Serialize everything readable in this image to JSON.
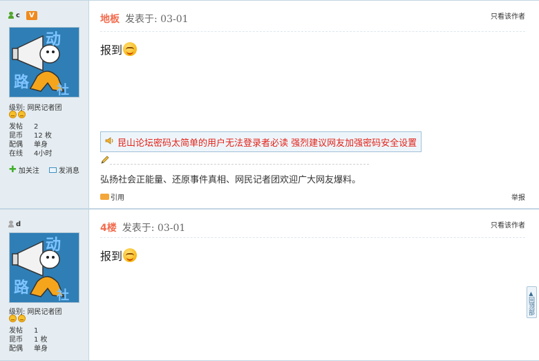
{
  "posts": [
    {
      "username": "c",
      "badge": "V",
      "level_label": "级别: 网民记者团",
      "stats": [
        {
          "k": "发帖",
          "v": "2"
        },
        {
          "k": "昆币",
          "v": "12 枚"
        },
        {
          "k": "配偶",
          "v": "单身"
        },
        {
          "k": "在线",
          "v": "4小时"
        }
      ],
      "follow_label": "加关注",
      "message_label": "发消息",
      "floor": "地板",
      "posted": "发表于: 03-01",
      "only_author": "只看该作者",
      "content": "报到",
      "notice": "昆山论坛密码太简单的用户无法登录者必读 强烈建议网友加强密码安全设置",
      "signature": "弘扬社会正能量、还原事件真相、网民记者团欢迎广大网友爆料。",
      "quote_label": "引用",
      "report_label": "举报"
    },
    {
      "username": "d",
      "level_label": "级别: 网民记者团",
      "stats": [
        {
          "k": "发帖",
          "v": "1"
        },
        {
          "k": "昆币",
          "v": "1 枚"
        },
        {
          "k": "配偶",
          "v": "单身"
        }
      ],
      "floor": "4楼",
      "posted": "发表于: 03-01",
      "only_author": "只看该作者",
      "content": "报到"
    }
  ],
  "side_button": "回顶部",
  "avatar_text": [
    "动",
    "路",
    "社"
  ],
  "colors": {
    "accent": "#f26c4f",
    "notice": "#e2231a",
    "sidebar": "#e5edf2"
  }
}
